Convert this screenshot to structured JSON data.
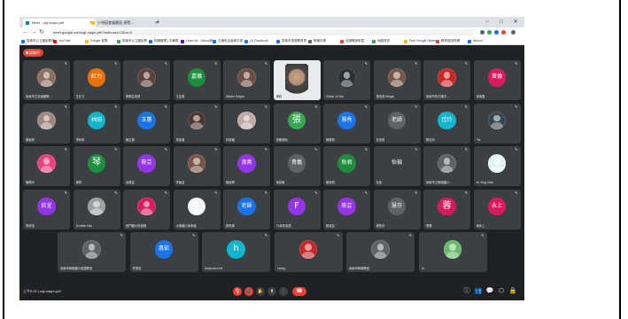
{
  "browser": {
    "tabs": [
      {
        "label": "Meet - ugt-vaqm-pbf",
        "active": true,
        "favicon_color": "#00897b"
      },
      {
        "label": "小視窗會議畫面-預覽-...",
        "active": false,
        "favicon_color": "#fbbc04"
      }
    ],
    "new_tab": "+",
    "window_controls": {
      "minimize": "−",
      "maximize": "□",
      "close": "✕"
    },
    "nav": {
      "back": "←",
      "forward": "→",
      "reload": "↻"
    },
    "url": "meet.google.com/ugt-vaqm-pbf?authuser=0&hs=0",
    "bookmarks": [
      {
        "label": "臺南市公立國民教育",
        "color": "#1a73e8"
      },
      {
        "label": "YouTube",
        "color": "#ff0000"
      },
      {
        "label": "Google 相簿",
        "color": "#fbbc04"
      },
      {
        "label": "臺南市公立國民教...",
        "color": "#34a853"
      },
      {
        "label": "知識管理 | 中華電...",
        "color": "#1a73e8"
      },
      {
        "label": "Learn.tcl - Yahoo奇...",
        "color": "#6001d2"
      },
      {
        "label": "交通安全宣導平臺",
        "color": "#1a73e8"
      },
      {
        "label": "(1) Facebook",
        "color": "#1877f2"
      },
      {
        "label": "臺南市英語教育資...",
        "color": "#1a73e8"
      },
      {
        "label": "明道中學",
        "color": "#5f6368"
      },
      {
        "label": "全國教師研習",
        "color": "#ea4335"
      },
      {
        "label": "地圖資訊",
        "color": "#34a853"
      },
      {
        "label": "Free Google Slides...",
        "color": "#fbbc04"
      },
      {
        "label": "教育部因材網",
        "color": "#ea4335"
      },
      {
        "label": "dict.ncl",
        "color": "#1a73e8"
      }
    ]
  },
  "meeting": {
    "recording_label": "錄製中",
    "participants_row1": [
      {
        "name": "臺南市立安南國際...",
        "avatar": "photo",
        "bg": "#8d6e63"
      },
      {
        "name": "王紅力",
        "avatar": "紅力",
        "bg": "#e8710a"
      },
      {
        "name": "蔡曉芸老師",
        "avatar": "photo",
        "bg": "#5d4037"
      },
      {
        "name": "王嘉儀",
        "avatar": "嘉儀",
        "bg": "#1e8e3e"
      },
      {
        "name": "Allister Hsiyao",
        "avatar": "photo",
        "bg": "#6d4c41"
      },
      {
        "name": "陳鈺",
        "avatar": "video",
        "bg": "#ffffff"
      },
      {
        "name": "Chiaw Ju Yao",
        "avatar": "photo",
        "bg": "#263238"
      },
      {
        "name": "蕭伯茹 Megan",
        "avatar": "photo",
        "bg": "#795548"
      },
      {
        "name": "臺南市安平國中...",
        "avatar": "photo",
        "bg": "#c62828"
      },
      {
        "name": "黃儀雙",
        "avatar": "黃儀",
        "bg": "#d81b60"
      }
    ],
    "participants_row2": [
      {
        "name": "楊鈺婷",
        "avatar": "photo",
        "bg": "#a1887f"
      },
      {
        "name": "李林莉",
        "avatar": "林田",
        "bg": "#12b5cb"
      },
      {
        "name": "陳玉蕙",
        "avatar": "玉蕙",
        "bg": "#1a73e8"
      },
      {
        "name": "林俊雅",
        "avatar": "photo",
        "bg": "#4e342e"
      },
      {
        "name": "林家穎",
        "avatar": "photo",
        "bg": "#bcaaa4"
      },
      {
        "name": "張陳靜怡",
        "avatar": "張",
        "bg": "#34a853"
      },
      {
        "name": "楊雅秀",
        "avatar": "雅秀",
        "bg": "#1a73e8"
      },
      {
        "name": "莊老師",
        "avatar": "老師",
        "bg": "#5f6368"
      },
      {
        "name": "蔡佳玲",
        "avatar": "佳玲",
        "bg": "#12b5cb"
      },
      {
        "name": "Pei",
        "avatar": "photo",
        "bg": "#37474f"
      }
    ],
    "participants_row3": [
      {
        "name": "陳佩玲",
        "avatar": "photo",
        "bg": "#ec407a"
      },
      {
        "name": "謝琴",
        "avatar": "琴",
        "bg": "#1e8e3e"
      },
      {
        "name": "余筱芸",
        "avatar": "筱芸",
        "bg": "#9334e6"
      },
      {
        "name": "許麗芸",
        "avatar": "photo",
        "bg": "#795548"
      },
      {
        "name": "陳淑菁",
        "avatar": "淑菁",
        "bg": "#9334e6"
      },
      {
        "name": "陳貴義",
        "avatar": "貴義",
        "bg": "#5f6368"
      },
      {
        "name": "蔡秋君",
        "avatar": "秋君",
        "bg": "#1e8e3e"
      },
      {
        "name": "杜怡",
        "avatar": "怡禎",
        "bg": "#3c4043"
      },
      {
        "name": "臺南市立和順國小...",
        "avatar": "person",
        "bg": "#5f6368"
      },
      {
        "name": "Yu Ying Chen",
        "avatar": "photo",
        "bg": "#e0f2f1"
      }
    ],
    "participants_row4": [
      {
        "name": "李欣怡",
        "avatar": "欣宜",
        "bg": "#9334e6"
      },
      {
        "name": "Jennifer Hsu",
        "avatar": "photo",
        "bg": "#9e9e9e"
      },
      {
        "name": "西門國小柯淑雅",
        "avatar": "person",
        "bg": "#d81b60"
      },
      {
        "name": "大德國小邱禾蓓",
        "avatar": "photo",
        "bg": "#f5f5f5"
      },
      {
        "name": "蔡老師",
        "avatar": "老師",
        "bg": "#1a73e8"
      },
      {
        "name": "F2為有英語",
        "avatar": "F",
        "bg": "#9334e6"
      },
      {
        "name": "蔡淑芸",
        "avatar": "筱芸",
        "bg": "#9334e6"
      },
      {
        "name": "謝慧芬",
        "avatar": "慧芬",
        "bg": "#5f6368"
      },
      {
        "name": "曹蓉",
        "avatar": "蓉",
        "bg": "#d81b60"
      },
      {
        "name": "陳永上",
        "avatar": "永上",
        "bg": "#d81b60"
      }
    ],
    "participants_row5": [
      {
        "name": "臺南市和順國小英語教室",
        "avatar": "person",
        "bg": "#5f6368"
      },
      {
        "name": "許惠茹",
        "avatar": "惠茹",
        "bg": "#1a73e8"
      },
      {
        "name": "tonymoon.chli",
        "avatar": "h",
        "bg": "#12b5cb"
      },
      {
        "name": "hsiung",
        "avatar": "photo",
        "bg": "#c62828"
      },
      {
        "name": "臺南市和順教室",
        "avatar": "person",
        "bg": "#5f6368"
      },
      {
        "name": "lin",
        "avatar": "photo",
        "bg": "#66bb6a"
      }
    ],
    "meeting_info": "上午9:02 | ugt-vaqm-pbf",
    "controls": {
      "mic": "🎙",
      "camera": "📹",
      "hand": "✋",
      "present": "⬆",
      "more": "⋮",
      "hangup": "☎"
    },
    "right_icons": {
      "info": "ⓘ",
      "people": "👥",
      "chat": "💬",
      "activities": "⬡",
      "lock": "🔒"
    },
    "colors": {
      "meet_bg": "#202124",
      "tile_bg": "#3c4043",
      "danger": "#ea4335"
    }
  }
}
